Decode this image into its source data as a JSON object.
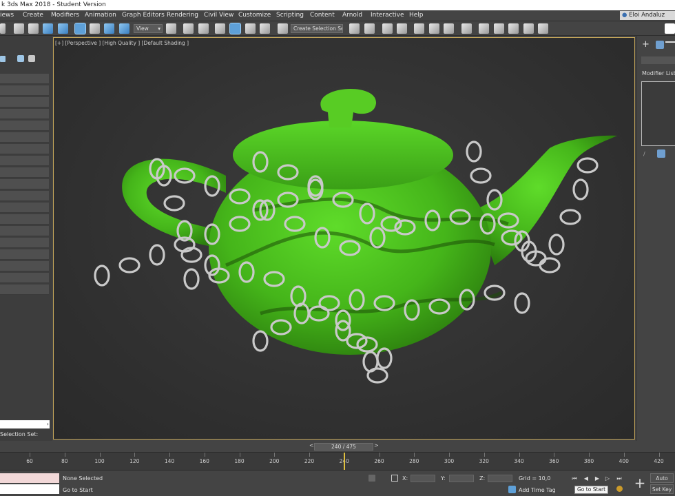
{
  "window": {
    "title": "k 3ds Max 2018 - Student Version"
  },
  "menu": {
    "items": [
      "iews",
      "Create",
      "Modifiers",
      "Animation",
      "Graph Editors",
      "Rendering",
      "Civil View",
      "Customize",
      "Scripting",
      "Content",
      "Arnold",
      "Interactive",
      "Help"
    ],
    "user": "Eloi Andaluz"
  },
  "toolbar": {
    "view_select": "View",
    "selection_set": "Create Selection Se"
  },
  "viewport": {
    "label": "[+] [Perspective ] [High Quality ] [Default Shading ]",
    "teapot_color": "#4fc21e",
    "background_color": "#2f2f2f"
  },
  "left_panel": {
    "selection_set_label": "Selection Set:"
  },
  "command_panel": {
    "modifier_list_label": "Modifier List"
  },
  "timeline": {
    "frame_counter": "240 / 475",
    "ticks": [
      "60",
      "80",
      "100",
      "120",
      "140",
      "160",
      "180",
      "200",
      "220",
      "240",
      "260",
      "280",
      "300",
      "320",
      "340",
      "360",
      "380",
      "400",
      "420"
    ],
    "current_frame": 240
  },
  "status": {
    "selection": "None Selected",
    "prompt": "Go to Start",
    "x_label": "X:",
    "y_label": "Y:",
    "z_label": "Z:",
    "grid": "Grid = 10,0",
    "add_time_tag": "Add Time Tag",
    "auto_key": "Auto Key",
    "set_key": "Set Key",
    "tooltip": "Go to Start"
  }
}
